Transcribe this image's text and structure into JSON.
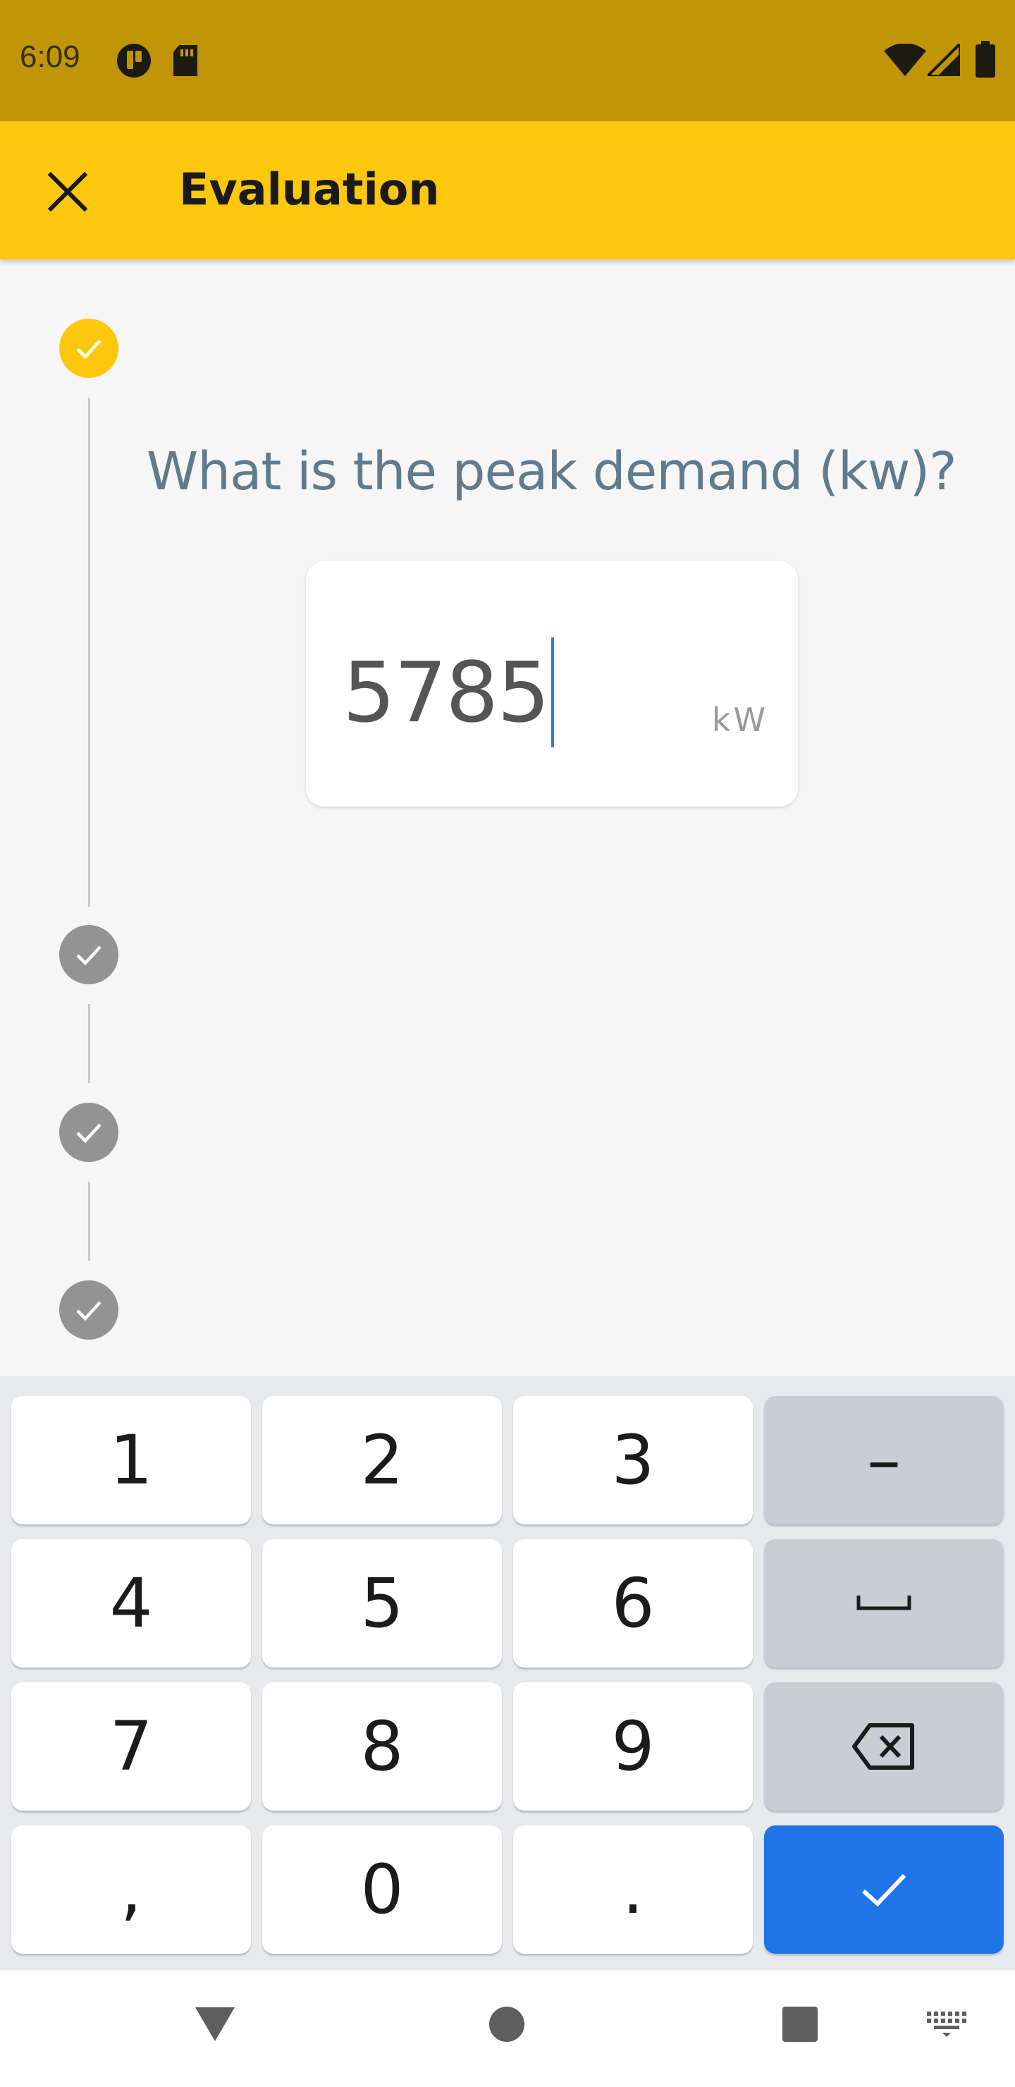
{
  "status_bar": {
    "time": "6:09",
    "icons": [
      "notification-app-icon",
      "sd-card-icon",
      "wifi-icon",
      "signal-icon",
      "battery-icon"
    ]
  },
  "app_bar": {
    "title": "Evaluation",
    "close_icon": "close-icon"
  },
  "stepper": {
    "steps": [
      {
        "state": "active-complete"
      },
      {
        "state": "complete"
      },
      {
        "state": "complete"
      },
      {
        "state": "complete"
      }
    ]
  },
  "question": {
    "text": "What is the peak demand (kw)?",
    "input_value": "5785",
    "unit": "kW"
  },
  "keyboard": {
    "rows": [
      [
        "1",
        "2",
        "3",
        "–"
      ],
      [
        "4",
        "5",
        "6",
        "space"
      ],
      [
        "7",
        "8",
        "9",
        "backspace"
      ],
      [
        ",",
        "0",
        ".",
        "done"
      ]
    ],
    "key_labels": {
      "k1": "1",
      "k2": "2",
      "k3": "3",
      "dash": "–",
      "k4": "4",
      "k5": "5",
      "k6": "6",
      "k7": "7",
      "k8": "8",
      "k9": "9",
      "comma": ",",
      "k0": "0",
      "period": "."
    }
  },
  "nav_bar": {
    "buttons": [
      "back-icon",
      "home-icon",
      "recents-icon",
      "keyboard-switch-icon"
    ]
  },
  "colors": {
    "status_bar": "#c09507",
    "app_bar": "#fdc70e",
    "question_text": "#5f7b8d",
    "enter_key": "#1f74e8",
    "caret": "#3b7be0"
  }
}
